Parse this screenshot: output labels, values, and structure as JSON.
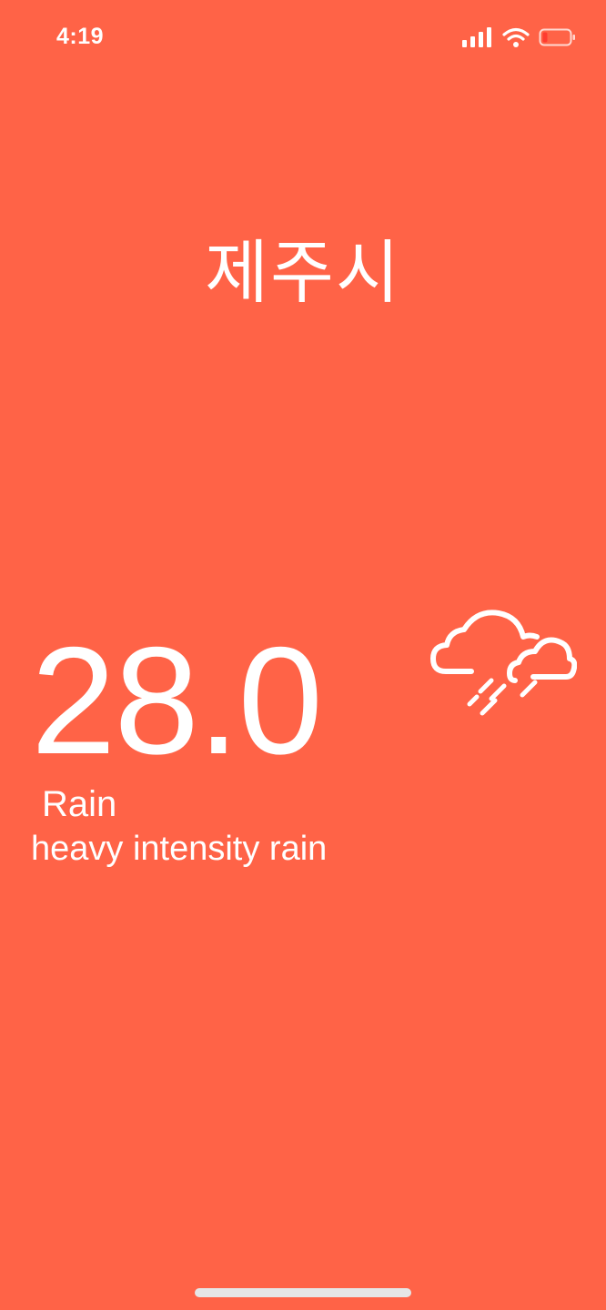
{
  "status_bar": {
    "time": "4:19",
    "icons": [
      "cellular-signal-icon",
      "wifi-icon",
      "battery-icon"
    ]
  },
  "location": {
    "city": "제주시"
  },
  "weather": {
    "temperature": "28.0",
    "condition": "Rain",
    "description": "heavy intensity rain",
    "icon": "cloud-rain-icon"
  },
  "colors": {
    "background": "#FF6347",
    "foreground": "#FFFFFF",
    "battery_low": "#FF3B30"
  }
}
